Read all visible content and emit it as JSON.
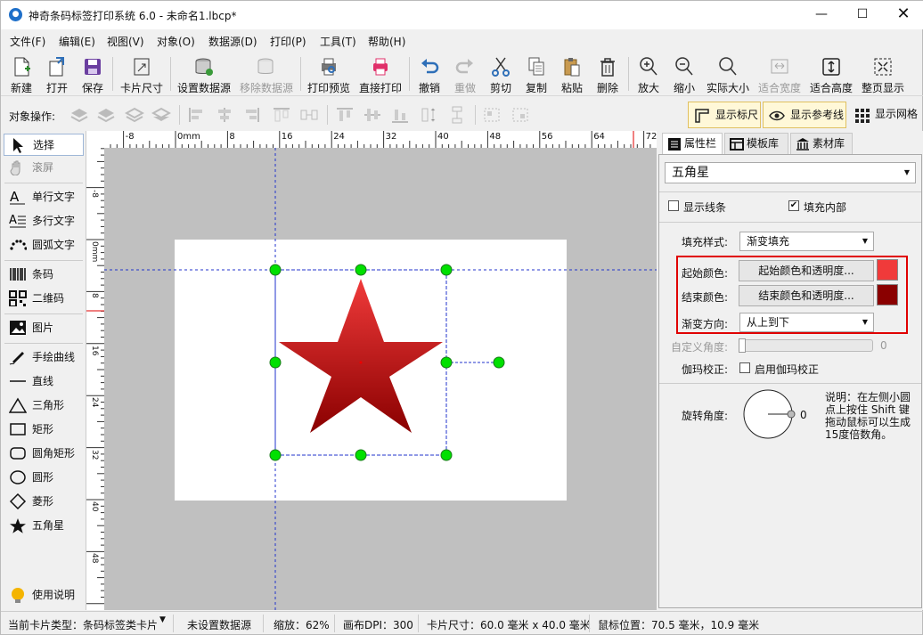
{
  "title": {
    "text": "神奇条码标签打印系统 6.0 - 未命名1.lbcp*",
    "icon": "app-icon"
  },
  "menu": [
    "文件(F)",
    "编辑(E)",
    "视图(V)",
    "对象(O)",
    "数据源(D)",
    "打印(P)",
    "工具(T)",
    "帮助(H)"
  ],
  "toolbar": {
    "new": "新建",
    "open": "打开",
    "save": "保存",
    "card_size": "卡片尺寸",
    "set_ds": "设置数据源",
    "remove_ds": "移除数据源",
    "print_preview": "打印预览",
    "direct_print": "直接打印",
    "undo": "撤销",
    "redo": "重做",
    "cut": "剪切",
    "copy": "复制",
    "paste": "粘贴",
    "delete": "删除",
    "zoom_in": "放大",
    "zoom_out": "缩小",
    "actual_size": "实际大小",
    "fit_width": "适合宽度",
    "fit_height": "适合高度",
    "whole_page": "整页显示"
  },
  "objbar": {
    "label": "对象操作:",
    "show_ruler": "显示标尺",
    "show_guides": "显示参考线",
    "show_grid": "显示网格"
  },
  "tools": {
    "select": "选择",
    "scroll": "滚屏",
    "single_text": "单行文字",
    "multi_text": "多行文字",
    "arc_text": "圆弧文字",
    "barcode": "条码",
    "qrcode": "二维码",
    "image": "图片",
    "freehand": "手绘曲线",
    "line": "直线",
    "triangle": "三角形",
    "rectangle": "矩形",
    "rounded_rect": "圆角矩形",
    "circle": "圆形",
    "diamond": "菱形",
    "star": "五角星",
    "help": "使用说明"
  },
  "ruler": {
    "h": [
      "-8",
      "0mm",
      "8",
      "16",
      "24",
      "32",
      "40",
      "48",
      "56",
      "64",
      "72"
    ],
    "v": [
      "-8",
      "0mm",
      "8",
      "16",
      "24",
      "32",
      "40",
      "48"
    ]
  },
  "panel": {
    "tabs": [
      "属性栏",
      "模板库",
      "素材库"
    ],
    "object_type": "五角星",
    "show_lines": "显示线条",
    "fill_inside": "填充内部",
    "fill_style_label": "填充样式:",
    "fill_style_value": "渐变填充",
    "start_color_label": "起始颜色:",
    "start_color_btn": "起始颜色和透明度...",
    "end_color_label": "结束颜色:",
    "end_color_btn": "结束颜色和透明度...",
    "direction_label": "渐变方向:",
    "direction_value": "从上到下",
    "custom_angle_label": "自定义角度:",
    "custom_angle_value": "0",
    "gamma_label": "伽玛校正:",
    "gamma_check": "启用伽玛校正",
    "rotation_label": "旋转角度:",
    "rotation_value": "0",
    "note": [
      "说明：在左侧小圆",
      "点上按住 Shift 键",
      "拖动鼠标可以生成",
      "15度倍数角。"
    ]
  },
  "colors": {
    "start": "#f03a3a",
    "end": "#8a0000",
    "handle": "#00e000",
    "highlight": "#e00000"
  },
  "status": {
    "card_type": "当前卡片类型：条码标签类卡片",
    "datasource": "未设置数据源",
    "zoom": "缩放：62%",
    "dpi": "画布DPI：300",
    "card_size": "卡片尺寸：60.0 毫米 x 40.0 毫米",
    "mouse": "鼠标位置：70.5 毫米，10.9 毫米"
  }
}
